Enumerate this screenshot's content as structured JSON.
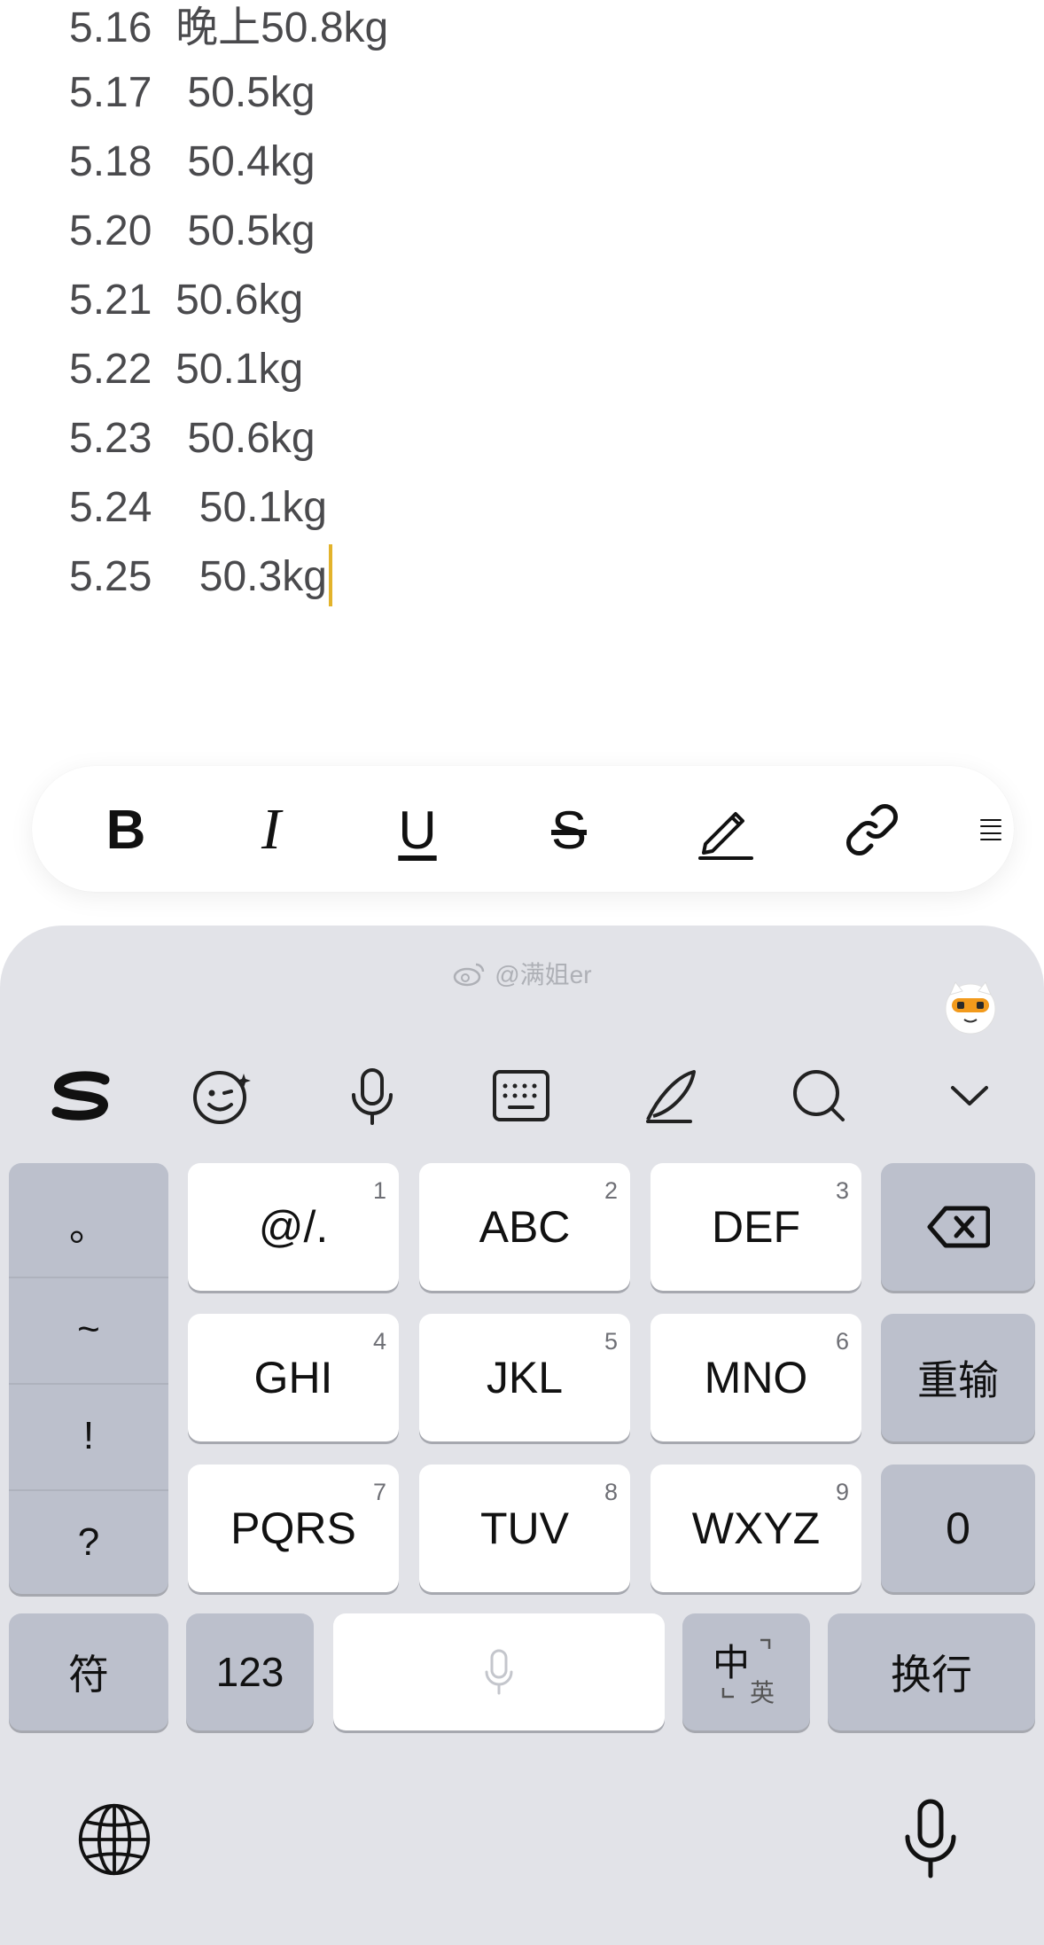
{
  "notes": {
    "lines": [
      "5.16  晚上50.8kg",
      "5.17   50.5kg",
      "5.18   50.4kg",
      "5.20   50.5kg",
      "5.21  50.6kg",
      "5.22  50.1kg",
      "5.23   50.6kg",
      "5.24    50.1kg",
      "5.25    50.3kg"
    ]
  },
  "format_bar": {
    "bold": "B",
    "italic": "I",
    "underline": "U",
    "strike": "S"
  },
  "keyboard": {
    "watermark": "@满姐er",
    "punct": [
      "。",
      "~",
      "!",
      "?"
    ],
    "keys": {
      "k1": {
        "label": "@/.",
        "num": "1"
      },
      "k2": {
        "label": "ABC",
        "num": "2"
      },
      "k3": {
        "label": "DEF",
        "num": "3"
      },
      "k4": {
        "label": "GHI",
        "num": "4"
      },
      "k5": {
        "label": "JKL",
        "num": "5"
      },
      "k6": {
        "label": "MNO",
        "num": "6"
      },
      "k7": {
        "label": "PQRS",
        "num": "7"
      },
      "k8": {
        "label": "TUV",
        "num": "8"
      },
      "k9": {
        "label": "WXYZ",
        "num": "9"
      }
    },
    "reenter": "重输",
    "zero": "0",
    "symbols": "符",
    "numbers": "123",
    "lang_main": "中",
    "lang_alt": "英",
    "newline": "换行"
  },
  "colors": {
    "caret": "#e3b32b",
    "keyboard_bg": "#e2e3e8",
    "key_dark": "#bcc0cc"
  }
}
